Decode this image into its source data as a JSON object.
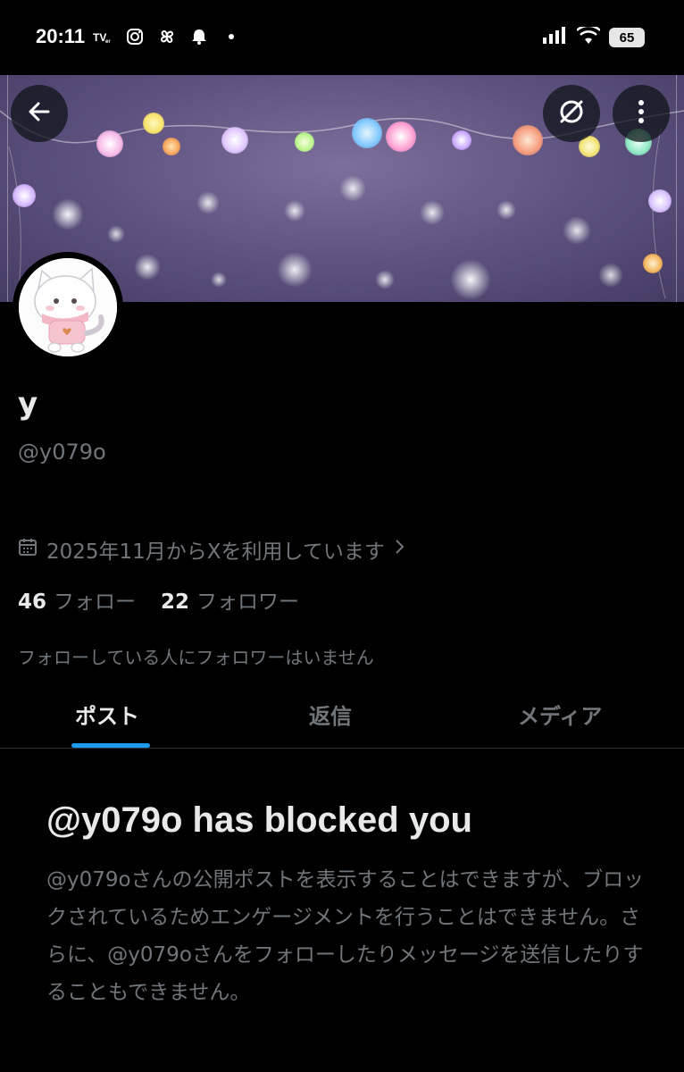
{
  "status_bar": {
    "time": "20:11",
    "left_icons": [
      "tver-icon",
      "instagram-icon",
      "pinwheel-icon",
      "bell-icon",
      "dot-icon"
    ],
    "right_icons": [
      "signal-icon",
      "wifi-icon"
    ],
    "battery": "65"
  },
  "header": {
    "back_icon": "arrow-left-icon",
    "right_buttons": [
      "grok-icon",
      "more-vertical-icon"
    ]
  },
  "profile": {
    "display_name": "y",
    "handle": "@y079o",
    "joined": "2025年11月からXを利用しています",
    "following_count": "46",
    "following_label": "フォロー",
    "followers_count": "22",
    "followers_label": "フォロワー",
    "mutual_note": "フォローしている人にフォロワーはいません"
  },
  "tabs": [
    {
      "label": "ポスト",
      "active": true
    },
    {
      "label": "返信",
      "active": false
    },
    {
      "label": "メディア",
      "active": false
    }
  ],
  "blocked": {
    "title": "@y079o has blocked you",
    "body": "@y079oさんの公開ポストを表示することはできますが、ブロックされているためエンゲージメントを行うことはできません。さらに、@y079oさんをフォローしたりメッセージを送信したりすることもできません。"
  },
  "colors": {
    "background": "#000000",
    "accent": "#1d9bf0",
    "secondary_text": "#71767b",
    "primary_text": "#e7e9ea"
  }
}
